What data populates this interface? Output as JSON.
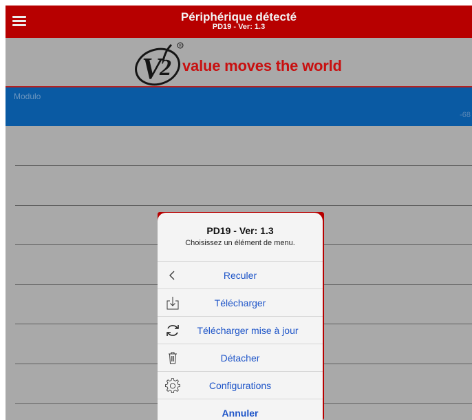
{
  "header": {
    "title": "Périphérique détecté",
    "subtitle": "PD19 - Ver: 1.3",
    "menu_icon": "hamburger-menu-icon",
    "background": "#b70000"
  },
  "logo": {
    "mark": "V2",
    "tagline": "value moves the world",
    "color": "#c81010"
  },
  "module": {
    "label": "Modulo",
    "value": "-68",
    "background": "#0a5aa3"
  },
  "action_sheet": {
    "title": "PD19 - Ver: 1.3",
    "message": "Choisissez un élément de menu.",
    "items": [
      {
        "label": "Reculer",
        "icon": "chevron-left-icon"
      },
      {
        "label": "Télécharger",
        "icon": "download-icon"
      },
      {
        "label": "Télécharger mise à jour",
        "icon": "refresh-icon"
      },
      {
        "label": "Détacher",
        "icon": "trash-icon"
      },
      {
        "label": "Configurations",
        "icon": "gear-icon"
      }
    ],
    "cancel_label": "Annuler",
    "link_color": "#1d54c8"
  }
}
